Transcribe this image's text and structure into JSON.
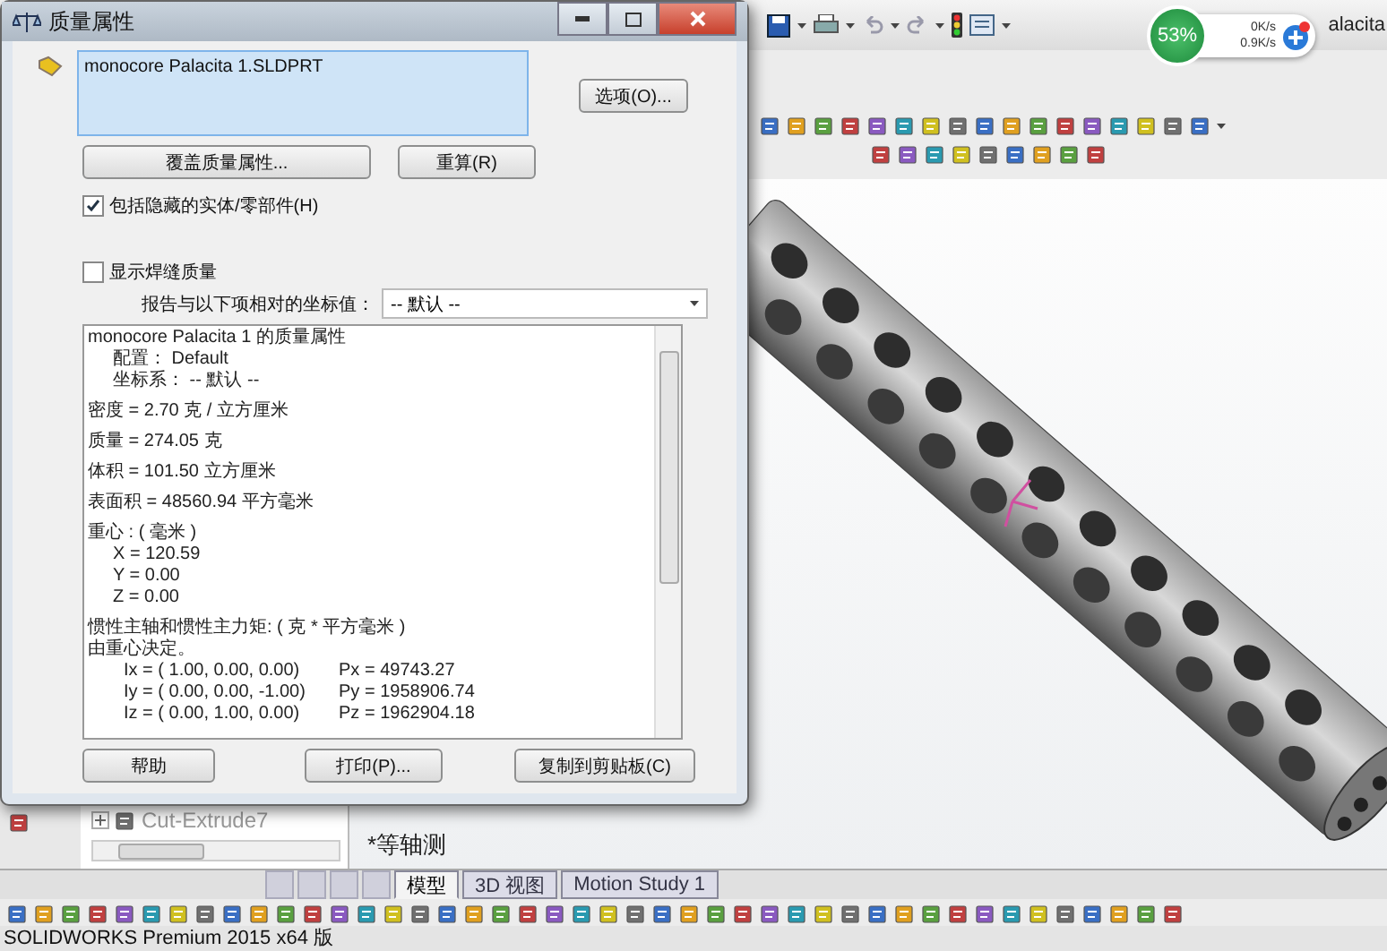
{
  "dialog": {
    "title": "质量属性",
    "selection_list": [
      "monocore Palacita 1.SLDPRT"
    ],
    "options_button": "选项(O)...",
    "override_button": "覆盖质量属性...",
    "recalculate_button": "重算(R)",
    "checkboxes": [
      {
        "label": "包括隐藏的实体/零部件(H)",
        "checked": true
      },
      {
        "label": "显示焊缝质量",
        "checked": false
      }
    ],
    "coordinate_label": "报告与以下项相对的坐标值：",
    "coordinate_dropdown": "-- 默认 --",
    "report": {
      "sections": [
        {
          "lines": [
            {
              "text": "monocore Palacita 1 的质量属性",
              "kind": "plain"
            },
            {
              "text": "配置： Default",
              "kind": "indent"
            },
            {
              "text": "坐标系： -- 默认 --",
              "kind": "indent"
            }
          ]
        },
        {
          "lines": [
            {
              "text": "密度 = 2.70 克 / 立方厘米",
              "kind": "plain"
            }
          ]
        },
        {
          "lines": [
            {
              "text": "质量 = 274.05 克",
              "kind": "plain"
            }
          ]
        },
        {
          "lines": [
            {
              "text": "体积 = 101.50 立方厘米",
              "kind": "plain"
            }
          ]
        },
        {
          "lines": [
            {
              "text": "表面积 = 48560.94  平方毫米",
              "kind": "plain"
            }
          ]
        },
        {
          "lines": [
            {
              "text": "重心 : ( 毫米 )",
              "kind": "plain"
            },
            {
              "text": "X = 120.59",
              "kind": "indent"
            },
            {
              "text": "Y = 0.00",
              "kind": "indent"
            },
            {
              "text": "Z = 0.00",
              "kind": "indent"
            }
          ]
        },
        {
          "lines": [
            {
              "text": "惯性主轴和惯性主力矩: ( 克 *  平方毫米 )",
              "kind": "plain"
            },
            {
              "text": "由重心决定。",
              "kind": "plain"
            }
          ]
        }
      ],
      "axes": [
        {
          "axis": "Ix = ( 1.00,  0.00,  0.00)",
          "moment": "Px = 49743.27"
        },
        {
          "axis": "Iy = ( 0.00,  0.00, -1.00)",
          "moment": "Py = 1958906.74"
        },
        {
          "axis": "Iz = ( 0.00,  1.00,  0.00)",
          "moment": "Pz = 1962904.18"
        }
      ]
    },
    "buttons": [
      "帮助",
      "打印(P)...",
      "复制到剪贴板(C)"
    ]
  },
  "document_title": "alacita",
  "network_widget": {
    "usage": "53%",
    "upload": "0K/s",
    "download": "0.9K/s"
  },
  "feature_tree": {
    "items": [
      {
        "label": "Cut-Extrude7",
        "expanded": false
      }
    ]
  },
  "viewport": {
    "view_label": "*等轴测"
  },
  "tabs": [
    {
      "label": "模型",
      "selected": true
    },
    {
      "label": "3D 视图",
      "selected": false
    },
    {
      "label": "Motion Study 1",
      "selected": false
    }
  ],
  "status_bar": "SOLIDWORKS Premium 2015 x64 版"
}
